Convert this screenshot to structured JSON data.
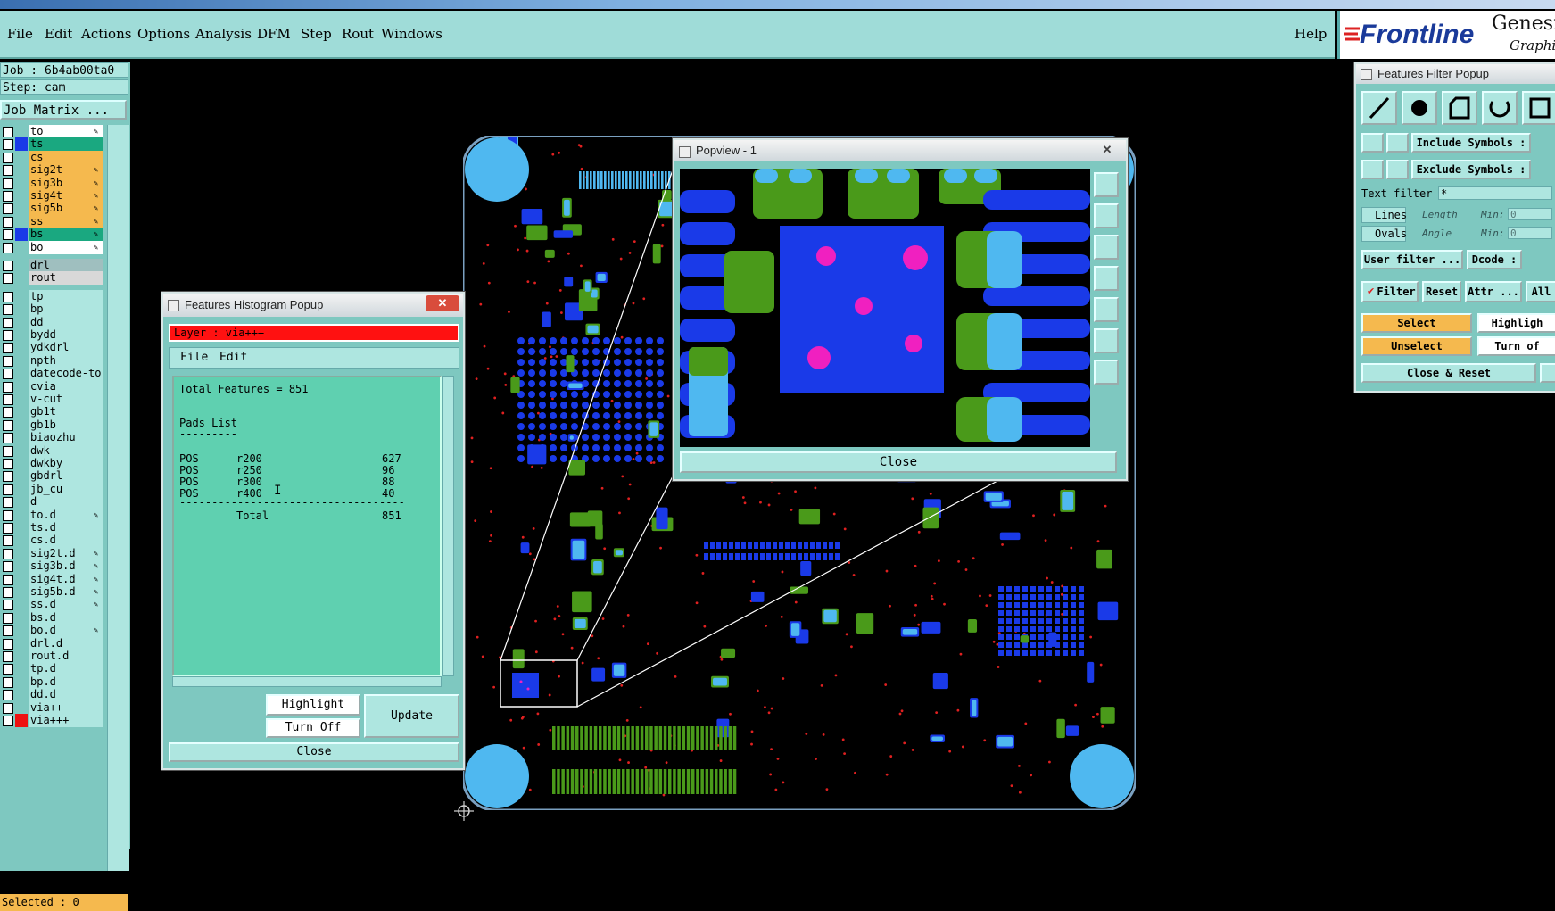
{
  "menubar": {
    "items": [
      "File",
      "Edit",
      "Actions",
      "Options",
      "Analysis",
      "DFM",
      "Step",
      "Rout",
      "Windows"
    ],
    "help": "Help"
  },
  "brand": {
    "logo": "Frontline",
    "title": "Genesis",
    "subtitle": "Graphic"
  },
  "left_panel": {
    "job": "Job : 6b4ab00ta0",
    "step": "Step: cam",
    "job_matrix": "Job Matrix ...",
    "layers": [
      {
        "name": "to",
        "color": "#ffffff",
        "sel": "",
        "edit": true
      },
      {
        "name": "ts",
        "color": "#1aa880",
        "sel": "#1a3ae8",
        "edit": false
      },
      {
        "name": "cs",
        "color": "#f5b94e",
        "sel": "",
        "edit": false
      },
      {
        "name": "sig2t",
        "color": "#f5b94e",
        "sel": "",
        "edit": true
      },
      {
        "name": "sig3b",
        "color": "#f5b94e",
        "sel": "",
        "edit": true
      },
      {
        "name": "sig4t",
        "color": "#f5b94e",
        "sel": "",
        "edit": true
      },
      {
        "name": "sig5b",
        "color": "#f5b94e",
        "sel": "",
        "edit": true
      },
      {
        "name": "ss",
        "color": "#f5b94e",
        "sel": "",
        "edit": true
      },
      {
        "name": "bs",
        "color": "#1aa880",
        "sel": "#1a3ae8",
        "edit": true
      },
      {
        "name": "bo",
        "color": "#ffffff",
        "sel": "",
        "edit": true
      },
      {
        "name": "drl",
        "color": "#9fbfbf",
        "sel": "",
        "edit": false
      },
      {
        "name": "rout",
        "color": "#d8d8d8",
        "sel": "",
        "edit": false
      },
      {
        "name": "tp",
        "color": "#aee6e0",
        "sel": "",
        "edit": false
      },
      {
        "name": "bp",
        "color": "#aee6e0",
        "sel": "",
        "edit": false
      },
      {
        "name": "dd",
        "color": "#aee6e0",
        "sel": "",
        "edit": false
      },
      {
        "name": "bydd",
        "color": "#aee6e0",
        "sel": "",
        "edit": false
      },
      {
        "name": "ydkdrl",
        "color": "#aee6e0",
        "sel": "",
        "edit": false
      },
      {
        "name": "npth",
        "color": "#aee6e0",
        "sel": "",
        "edit": false
      },
      {
        "name": "datecode-to",
        "color": "#aee6e0",
        "sel": "",
        "edit": false
      },
      {
        "name": "cvia",
        "color": "#aee6e0",
        "sel": "",
        "edit": false
      },
      {
        "name": "v-cut",
        "color": "#aee6e0",
        "sel": "",
        "edit": false
      },
      {
        "name": "gb1t",
        "color": "#aee6e0",
        "sel": "",
        "edit": false
      },
      {
        "name": "gb1b",
        "color": "#aee6e0",
        "sel": "",
        "edit": false
      },
      {
        "name": "biaozhu",
        "color": "#aee6e0",
        "sel": "",
        "edit": false
      },
      {
        "name": "dwk",
        "color": "#aee6e0",
        "sel": "",
        "edit": false
      },
      {
        "name": "dwkby",
        "color": "#aee6e0",
        "sel": "",
        "edit": false
      },
      {
        "name": "gbdrl",
        "color": "#aee6e0",
        "sel": "",
        "edit": false
      },
      {
        "name": "jb_cu",
        "color": "#aee6e0",
        "sel": "",
        "edit": false
      },
      {
        "name": "d",
        "color": "#aee6e0",
        "sel": "",
        "edit": false
      },
      {
        "name": "to.d",
        "color": "#aee6e0",
        "sel": "",
        "edit": true
      },
      {
        "name": "ts.d",
        "color": "#aee6e0",
        "sel": "",
        "edit": false
      },
      {
        "name": "cs.d",
        "color": "#aee6e0",
        "sel": "",
        "edit": false
      },
      {
        "name": "sig2t.d",
        "color": "#aee6e0",
        "sel": "",
        "edit": true
      },
      {
        "name": "sig3b.d",
        "color": "#aee6e0",
        "sel": "",
        "edit": true
      },
      {
        "name": "sig4t.d",
        "color": "#aee6e0",
        "sel": "",
        "edit": true
      },
      {
        "name": "sig5b.d",
        "color": "#aee6e0",
        "sel": "",
        "edit": true
      },
      {
        "name": "ss.d",
        "color": "#aee6e0",
        "sel": "",
        "edit": true
      },
      {
        "name": "bs.d",
        "color": "#aee6e0",
        "sel": "",
        "edit": false
      },
      {
        "name": "bo.d",
        "color": "#aee6e0",
        "sel": "",
        "edit": true
      },
      {
        "name": "drl.d",
        "color": "#aee6e0",
        "sel": "",
        "edit": false
      },
      {
        "name": "rout.d",
        "color": "#aee6e0",
        "sel": "",
        "edit": false
      },
      {
        "name": "tp.d",
        "color": "#aee6e0",
        "sel": "",
        "edit": false
      },
      {
        "name": "bp.d",
        "color": "#aee6e0",
        "sel": "",
        "edit": false
      },
      {
        "name": "dd.d",
        "color": "#aee6e0",
        "sel": "",
        "edit": false
      },
      {
        "name": "via++",
        "color": "#aee6e0",
        "sel": "",
        "edit": false
      },
      {
        "name": "via+++",
        "color": "#aee6e0",
        "sel": "#ee1111",
        "edit": false
      }
    ],
    "selected": "Selected : 0"
  },
  "histogram": {
    "title": "Features Histogram Popup",
    "layer": "Layer :  via+++",
    "menu": [
      "File",
      "Edit"
    ],
    "total_line": "Total Features = 851",
    "pads_header": "Pads List",
    "pads_underline": "---------",
    "rows": [
      {
        "pol": "POS",
        "sym": "r200",
        "count": "627"
      },
      {
        "pol": "POS",
        "sym": "r250",
        "count": "96"
      },
      {
        "pol": "POS",
        "sym": "r300",
        "count": "88"
      },
      {
        "pol": "POS",
        "sym": "r400",
        "count": "40"
      }
    ],
    "divider": "-----------------------------------",
    "total_label": "Total",
    "total_value": "851",
    "highlight": "Highlight",
    "turn_off": "Turn Off",
    "update": "Update",
    "close": "Close"
  },
  "popview": {
    "title": "Popview - 1",
    "close": "Close"
  },
  "filter": {
    "title": "Features Filter Popup",
    "include_symbols": "Include Symbols :",
    "exclude_symbols": "Exclude Symbols :",
    "text_filter": "Text filter",
    "text_filter_value": "*",
    "lines": "Lines",
    "ovals": "Ovals",
    "length": "Length",
    "angle": "Angle",
    "min": "Min:",
    "min_value": "0",
    "user_filter": "User filter ...",
    "dcode": "Dcode :",
    "filter_btn": "Filter",
    "reset": "Reset",
    "attr": "Attr ...",
    "all": "All",
    "select": "Select",
    "highlight": "Highligh",
    "unselect": "Unselect",
    "turn_off": "Turn of",
    "close_reset": "Close & Reset"
  },
  "colors": {
    "panel": "#7ec8c0",
    "field": "#aee6e0",
    "orange": "#f5b94e",
    "board_blue": "#1a3ae8",
    "board_light": "#4fb8f0",
    "board_green": "#4a9a1a",
    "pad_magenta": "#f020c0"
  }
}
